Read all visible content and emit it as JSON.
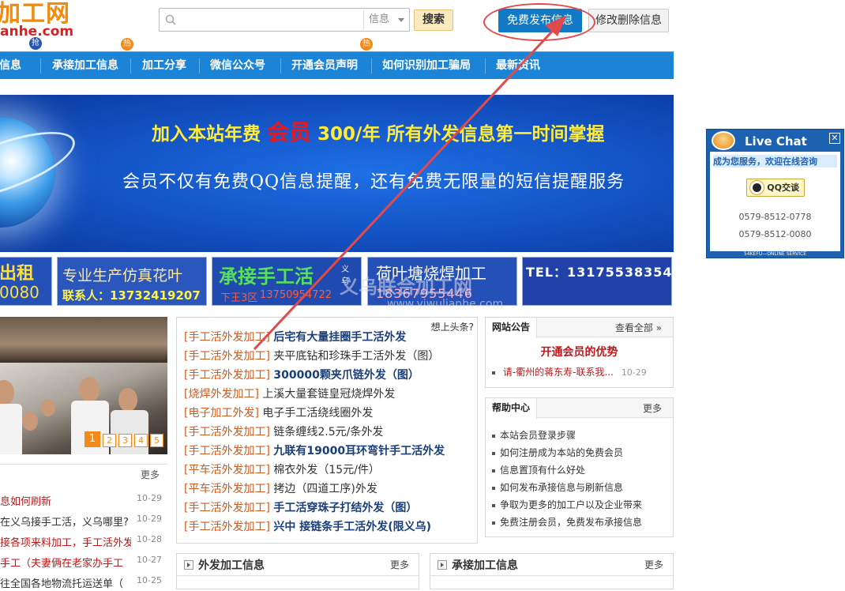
{
  "logo": {
    "line1": "加工网",
    "line2": "anhe.com"
  },
  "search": {
    "placeholder": "",
    "category": "信息",
    "button": "搜索"
  },
  "header": {
    "publish_button": "免费发布信息",
    "edit_button": "修改删除信息"
  },
  "nav": {
    "items": [
      "信息",
      "承接加工信息",
      "加工分享",
      "微信公众号",
      "开通会员声明",
      "如何识别加工骗局",
      "最新资讯"
    ],
    "badges": [
      "抢",
      "热",
      "热"
    ]
  },
  "banner": {
    "line1_pre": "加入本站年费",
    "line1_vip": "会员",
    "line1_post": "300/年  所有外发信息第一时间掌握",
    "line2": "会员不仅有免费QQ信息提醒，还有免费无限量的短信提醒服务"
  },
  "ads": {
    "a1_title": "出租",
    "a1_phone": "0080",
    "a2_title": "专业生产仿真花叶",
    "a2_contact": "联系人：13732419207",
    "a3_title": "承接手工活",
    "a3_side": "义乌",
    "a3_addr": "下王3区",
    "a3_phone": "13750954722",
    "a4_title": "荷叶塘烧焊加工",
    "a4_phone": "18367955446",
    "a5_title": "TEL：13175538354"
  },
  "watermark": {
    "line1": "义乌联合加工网",
    "line2": "www.yiwulianhe.com"
  },
  "slideshow": {
    "pages": [
      "1",
      "2",
      "3",
      "4",
      "5"
    ]
  },
  "left_news": {
    "more": "更多",
    "items": [
      {
        "title": "息如何刷新",
        "date": "10-29"
      },
      {
        "title": "在义乌接手工活，义乌哪里?",
        "date": "10-29"
      },
      {
        "title": "接各项来料加工，手工活外发",
        "date": "10-28"
      },
      {
        "title": "手工（夫妻俩在老家办手工",
        "date": "10-27"
      },
      {
        "title": "往全国各地物流托运送单（",
        "date": "10-25"
      }
    ]
  },
  "mid_list": {
    "headline_link": "想上头条?",
    "items": [
      {
        "category": "[手工活外发加工]",
        "title": "后宅有大量挂圈手工活外发"
      },
      {
        "category": "[手工活外发加工]",
        "title": "夹平底钻和珍珠手工活外发（图）"
      },
      {
        "category": "[手工活外发加工]",
        "title": "300000颗夹爪链外发（图）"
      },
      {
        "category": "[烧焊外发加工]",
        "title": "上溪大量套链皇冠烧焊外发"
      },
      {
        "category": "[电子加工外发]",
        "title": "电子手工活绕线圈外发"
      },
      {
        "category": "[手工活外发加工]",
        "title": "链条缠线2.5元/条外发"
      },
      {
        "category": "[手工活外发加工]",
        "title": "九联有19000耳环弯针手工活外发"
      },
      {
        "category": "[平车活外发加工]",
        "title": "棉衣外发（15元/件）"
      },
      {
        "category": "[平车活外发加工]",
        "title": "拷边（四道工序)外发"
      },
      {
        "category": "[手工活外发加工]",
        "title": "手工活穿珠子打结外发（图）"
      },
      {
        "category": "[手工活外发加工]",
        "title": "兴中 接链条手工活外发(限义乌)"
      }
    ]
  },
  "notice": {
    "tab": "网站公告",
    "more": "查看全部 »",
    "headline": "开通会员的优势",
    "item": "请-衢州的蒋东寿-联系我...",
    "item_date": "10-29"
  },
  "help": {
    "tab": "帮助中心",
    "more": "更多",
    "items": [
      "本站会员登录步骤",
      "如何注册成为本站的免费会员",
      "信息置顶有什么好处",
      "如何发布承接信息与刷新信息",
      "争取为更多的加工户以及企业带来",
      "免费注册会员，免费发布承接信息"
    ]
  },
  "sections": {
    "outsource": {
      "title": "外发加工信息",
      "more": "更多"
    },
    "undertake": {
      "title": "承接加工信息",
      "more": "更多"
    }
  },
  "livechat": {
    "title": "Live Chat",
    "welcome": "成为您服务，欢迎在线咨询",
    "qq_button": "QQ交谈",
    "phone1": "0579-8512-0778",
    "phone2": "0579-8512-0080",
    "footer": "54KEFU—ONLINE SERVICE"
  },
  "colors": {
    "nav_blue": "#1b84d6",
    "accent_orange": "#f28a1a",
    "annotation_red": "#e24a4a"
  }
}
